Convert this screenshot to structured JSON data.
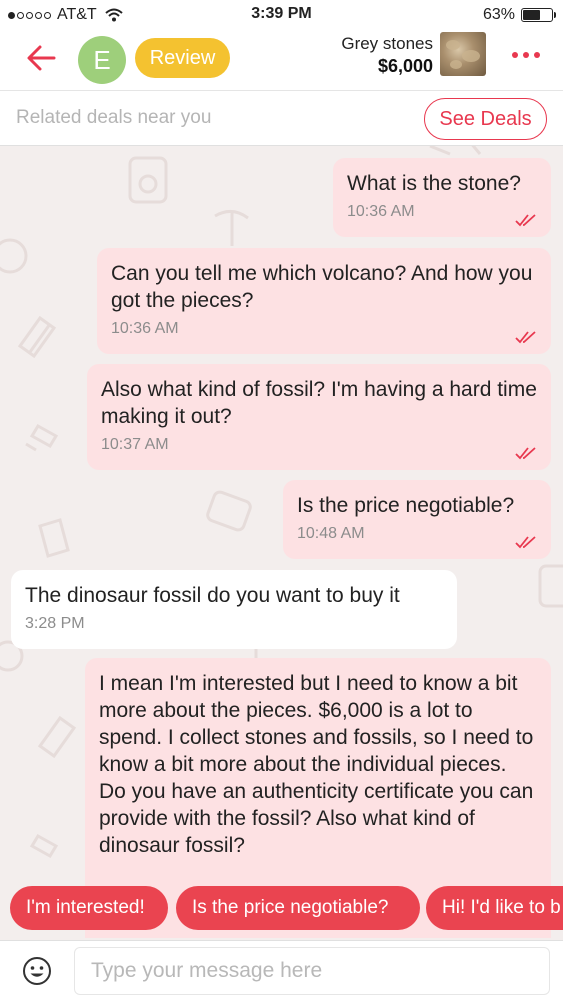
{
  "status_bar": {
    "carrier": "AT&T",
    "time": "3:39 PM",
    "battery": "63%",
    "battery_level": 0.63
  },
  "header": {
    "avatar_letter": "E",
    "review_label": "Review",
    "item_title": "Grey stones",
    "item_price": "$6,000"
  },
  "deals_bar": {
    "text": "Related deals near you",
    "button_label": "See Deals"
  },
  "messages": [
    {
      "direction": "out",
      "text": "What is the stone?",
      "time": "10:36 AM",
      "read": true
    },
    {
      "direction": "out",
      "text": "Can you tell me which volcano? And how you got the pieces?",
      "time": "10:36 AM",
      "read": true
    },
    {
      "direction": "out",
      "text": "Also what kind of fossil? I'm having a hard time making it out?",
      "time": "10:37 AM",
      "read": true
    },
    {
      "direction": "out",
      "text": "Is the price negotiable?",
      "time": "10:48 AM",
      "read": true
    },
    {
      "direction": "in",
      "text": "The dinosaur fossil do you want to buy it",
      "time": "3:28 PM"
    },
    {
      "direction": "out",
      "text": "I mean I'm interested but I need to know a bit more about the pieces. $6,000 is a lot to spend. I collect stones and fossils, so I need to know a bit more about the individual pieces. Do you have an authenticity certificate you can provide with the fossil? Also what kind of dinosaur fossil?"
    }
  ],
  "quick_replies": [
    "I'm interested!",
    "Is the price negotiable?",
    "Hi! I'd like to b"
  ],
  "input": {
    "placeholder": "Type your message here"
  },
  "colors": {
    "accent": "#e8384f",
    "review": "#f4c230",
    "avatar": "#9ecf7b",
    "outgoing_bubble": "#fde1e3",
    "chat_background": "#f3eeed"
  }
}
